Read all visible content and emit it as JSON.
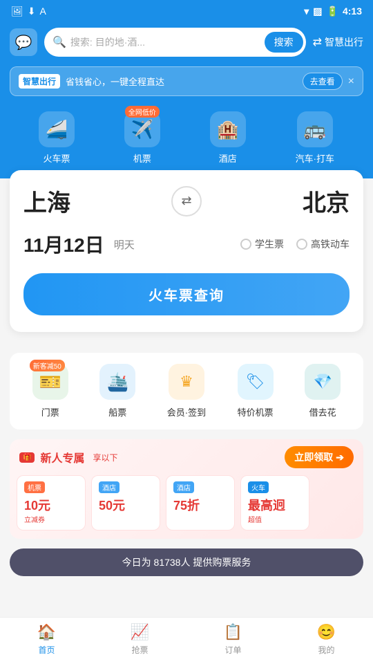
{
  "statusBar": {
    "time": "4:13",
    "icons": [
      "gallery",
      "download",
      "translate"
    ]
  },
  "header": {
    "searchPlaceholder": "搜索: 目的地·酒...",
    "searchBtn": "搜索",
    "smartTravel": "智慧出行",
    "transferIcon": "⇄"
  },
  "banner": {
    "tag": "智慧出行",
    "text": "省钱省心，一键全程直达",
    "checkBtn": "去查看",
    "closeBtn": "×"
  },
  "navItems": [
    {
      "icon": "🚄",
      "label": "火车票",
      "badge": null
    },
    {
      "icon": "✈️",
      "label": "机票",
      "badge": "全网低价"
    },
    {
      "icon": "🏨",
      "label": "酒店",
      "badge": null
    },
    {
      "icon": "🚌",
      "label": "汽车·打车",
      "badge": null
    }
  ],
  "searchCard": {
    "fromCity": "上海",
    "toCity": "北京",
    "swapIcon": "⇄",
    "date": "11月12日",
    "dateSub": "明天",
    "option1": "学生票",
    "option2": "高铁动车",
    "searchBtn": "火车票查询"
  },
  "services": [
    {
      "icon": "🎫",
      "label": "门票",
      "iconBg": "icon-green",
      "badge": "新客减50"
    },
    {
      "icon": "🛳️",
      "label": "船票",
      "iconBg": "icon-blue",
      "badge": null
    },
    {
      "icon": "👑",
      "label": "会员·签到",
      "iconBg": "icon-orange",
      "badge": null
    },
    {
      "icon": "🏷️",
      "label": "特价机票",
      "iconBg": "icon-lightblue",
      "badge": null
    },
    {
      "icon": "💎",
      "label": "借去花",
      "iconBg": "icon-teal",
      "badge": null
    }
  ],
  "newUser": {
    "tagIcon": "🎁",
    "title": "新人专属",
    "subtitle": "享以下",
    "claimBtn": "立即领取",
    "claimArrow": "➔",
    "coupons": [
      {
        "type": "机票",
        "typeClass": "coupon-type",
        "amount": "10元",
        "desc": "立减券"
      },
      {
        "type": "酒店",
        "typeClass": "coupon-type coupon-type-hotel",
        "amount": "50元",
        "desc": ""
      },
      {
        "type": "酒店",
        "typeClass": "coupon-type coupon-type-hotel2",
        "amount": "75折",
        "desc": ""
      },
      {
        "type": "火车",
        "typeClass": "coupon-type coupon-type-train",
        "amount": "最高迥",
        "desc": "超值"
      }
    ]
  },
  "toast": {
    "text": "今日为 81738人 提供购票服务"
  },
  "bottomNav": [
    {
      "icon": "🏠",
      "label": "首页",
      "active": true
    },
    {
      "icon": "📈",
      "label": "抢票",
      "active": false
    },
    {
      "icon": "📋",
      "label": "订单",
      "active": false
    },
    {
      "icon": "😊",
      "label": "我的",
      "active": false
    }
  ]
}
